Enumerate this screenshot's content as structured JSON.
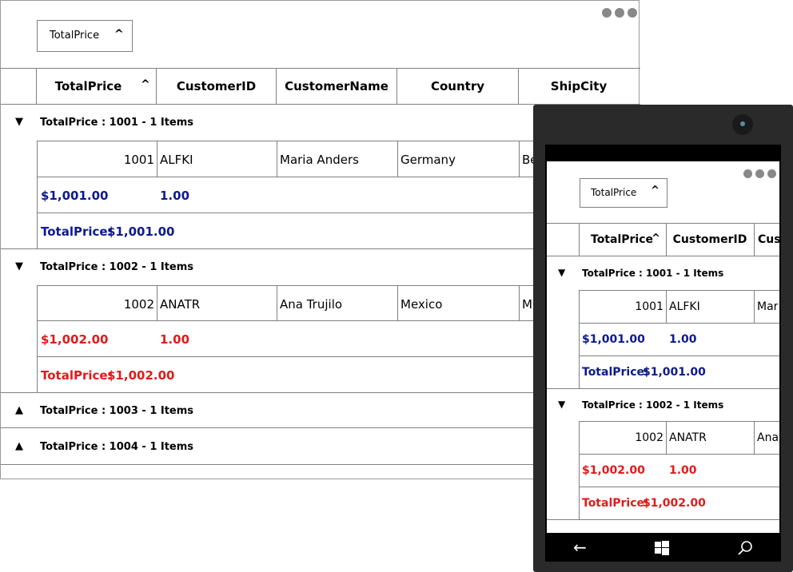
{
  "desktop": {
    "grouping_chip": "TotalPrice",
    "columns": [
      "TotalPrice",
      "CustomerID",
      "CustomerName",
      "Country",
      "ShipCity"
    ],
    "groups": [
      {
        "header": "TotalPrice : 1001 - 1 Items",
        "arrow": "▼",
        "row": {
          "total": "1001",
          "customer_id": "ALFKI",
          "name": "Maria Anders",
          "country": "Germany",
          "city": "Be"
        },
        "summary_price": "$1,001.00",
        "summary_qty": "1.00",
        "footer_label": "TotalPrice:",
        "footer_value": "$1,001.00"
      },
      {
        "header": "TotalPrice : 1002 - 1 Items",
        "arrow": "▼",
        "row": {
          "total": "1002",
          "customer_id": "ANATR",
          "name": "Ana Trujilo",
          "country": "Mexico",
          "city": "M"
        },
        "summary_price": "$1,002.00",
        "summary_qty": "1.00",
        "footer_label": "TotalPrice:",
        "footer_value": "$1,002.00"
      },
      {
        "header": "TotalPrice : 1003 - 1 Items",
        "arrow": "▲"
      },
      {
        "header": "TotalPrice : 1004 - 1 Items",
        "arrow": "▲"
      }
    ],
    "colors": {
      "blue": "#0d1a8c",
      "red": "#e01b1b"
    }
  },
  "phone": {
    "grouping_chip": "TotalPrice",
    "columns": [
      "TotalPrice",
      "CustomerID",
      "Cus"
    ],
    "groups": [
      {
        "header": "TotalPrice : 1001 - 1 Items",
        "arrow": "▼",
        "row": {
          "total": "1001",
          "customer_id": "ALFKI",
          "name": "Mar"
        },
        "summary_price": "$1,001.00",
        "summary_qty": "1.00",
        "footer_label": "TotalPrice:",
        "footer_value": "$1,001.00"
      },
      {
        "header": "TotalPrice : 1002 - 1 Items",
        "arrow": "▼",
        "row": {
          "total": "1002",
          "customer_id": "ANATR",
          "name": "Ana"
        },
        "summary_price": "$1,002.00",
        "summary_qty": "1.00",
        "footer_label": "TotalPrice:",
        "footer_value": "$1,002.00"
      }
    ],
    "nav_icons": [
      "back-icon",
      "windows-icon",
      "search-icon"
    ]
  }
}
